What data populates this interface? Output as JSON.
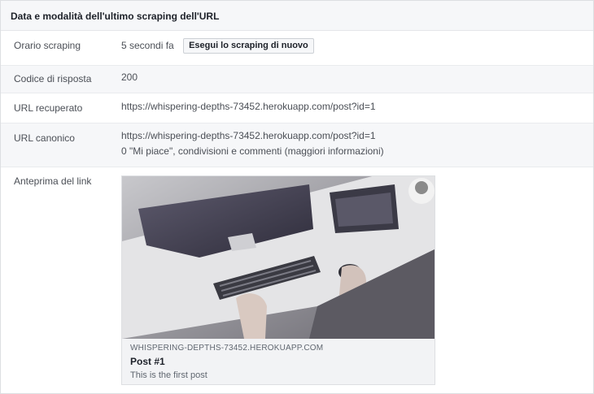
{
  "panel": {
    "title": "Data e modalità dell'ultimo scraping dell'URL"
  },
  "rows": {
    "scraping_time": {
      "label": "Orario scraping",
      "value": "5 secondi fa",
      "button": "Esegui lo scraping di nuovo"
    },
    "response_code": {
      "label": "Codice di risposta",
      "value": "200"
    },
    "fetched_url": {
      "label": "URL recuperato",
      "value": "https://whispering-depths-73452.herokuapp.com/post?id=1"
    },
    "canonical_url": {
      "label": "URL canonico",
      "value": "https://whispering-depths-73452.herokuapp.com/post?id=1",
      "engagement": "0 \"Mi piace\", condivisioni e commenti (maggiori informazioni)"
    },
    "link_preview": {
      "label": "Anteprima del link"
    }
  },
  "preview": {
    "domain": "WHISPERING-DEPTHS-73452.HEROKUAPP.COM",
    "title": "Post #1",
    "description": "This is the first post",
    "image_subject": "desk-workstation-photo"
  }
}
